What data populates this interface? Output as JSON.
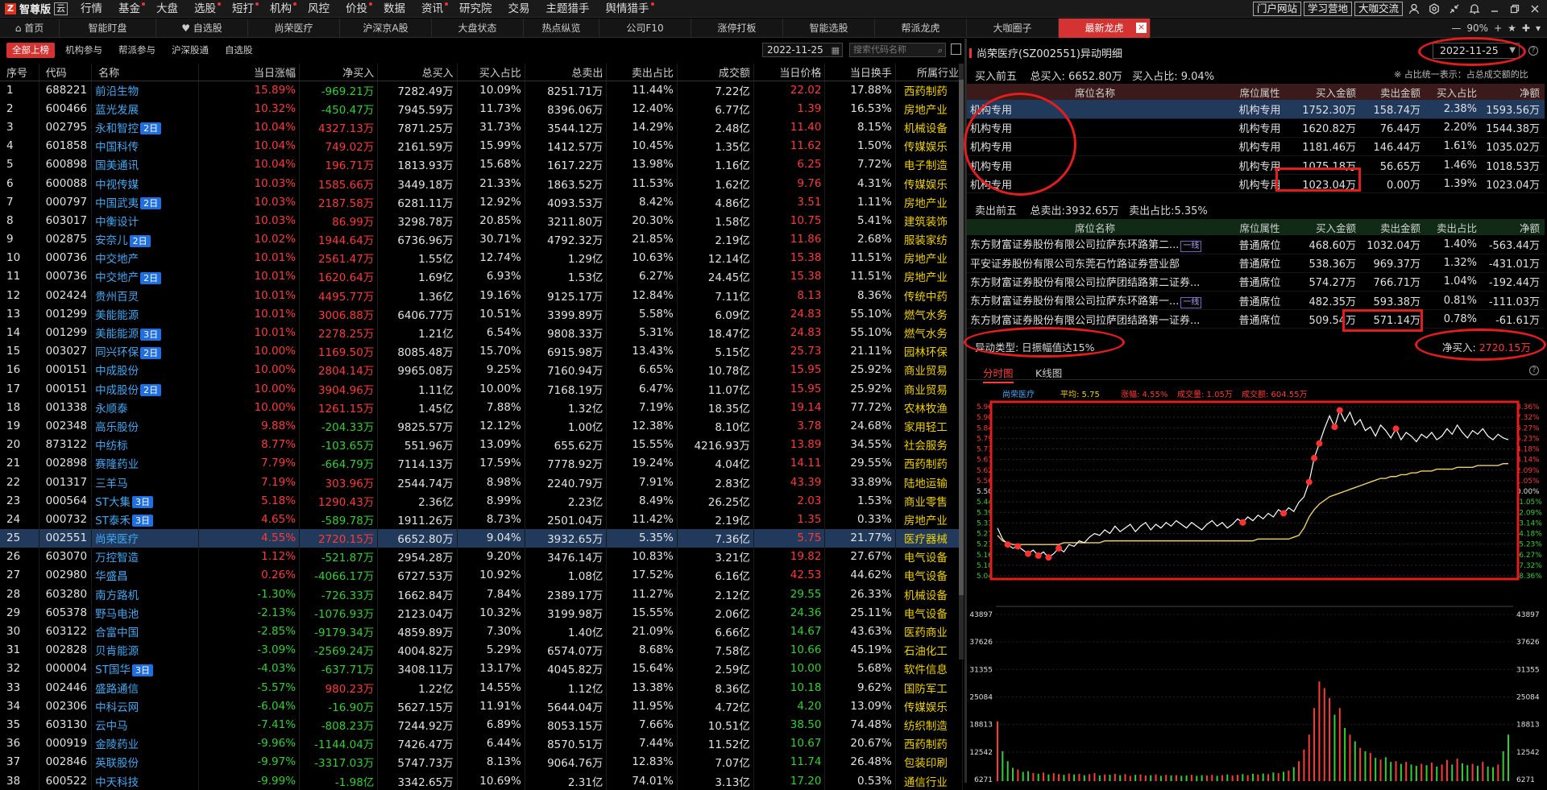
{
  "app": {
    "logo_glyph": "Z",
    "name": "智尊版",
    "edition": "云"
  },
  "menu": [
    {
      "label": "行情",
      "dot": false
    },
    {
      "label": "基金",
      "dot": true
    },
    {
      "label": "大盘",
      "dot": false
    },
    {
      "label": "选股",
      "dot": true
    },
    {
      "label": "短打",
      "dot": true
    },
    {
      "label": "机构",
      "dot": true
    },
    {
      "label": "风控",
      "dot": false
    },
    {
      "label": "价投",
      "dot": true
    },
    {
      "label": "数据",
      "dot": false
    },
    {
      "label": "资讯",
      "dot": true
    },
    {
      "label": "研究院",
      "dot": false
    },
    {
      "label": "交易",
      "dot": false
    },
    {
      "label": "主题猎手",
      "dot": false
    },
    {
      "label": "舆情猎手",
      "dot": true
    }
  ],
  "top_buttons": [
    "门户网站",
    "学习营地",
    "大咖交流"
  ],
  "tabs": [
    "首页",
    "智能盯盘",
    "自选股",
    "尚荣医疗",
    "沪深京A股",
    "大盘状态",
    "热点纵览",
    "公司F10",
    "涨停打板",
    "智能选股",
    "帮派龙虎",
    "大咖圈子",
    "最新龙虎"
  ],
  "tab_right": {
    "zoom": "90%"
  },
  "subtabs": [
    "全部上榜",
    "机构参与",
    "帮派参与",
    "沪深股通",
    "自选股"
  ],
  "date": "2022-11-25",
  "search_placeholder": "搜索代码名称",
  "table": {
    "headers": [
      "序号",
      "代码",
      "名称",
      "当日涨幅",
      "净买入",
      "总买入",
      "买入占比",
      "总卖出",
      "卖出占比",
      "成交额",
      "当日价格",
      "当日换手",
      "所属行业"
    ],
    "selected_row": 24,
    "rows": [
      [
        "1",
        "688221",
        "前沿生物",
        "",
        "15.89%",
        "-969.21万",
        "7282.49万",
        "10.09%",
        "8251.71万",
        "11.44%",
        "7.22亿",
        "22.02",
        "17.88%",
        "西药制药"
      ],
      [
        "2",
        "600466",
        "蓝光发展",
        "",
        "10.32%",
        "-450.47万",
        "7945.59万",
        "11.73%",
        "8396.06万",
        "12.40%",
        "6.77亿",
        "1.39",
        "16.53%",
        "房地产业"
      ],
      [
        "3",
        "002795",
        "永和智控",
        "2日",
        "10.04%",
        "4327.13万",
        "7871.25万",
        "31.73%",
        "3544.12万",
        "14.29%",
        "2.48亿",
        "11.40",
        "8.15%",
        "机械设备"
      ],
      [
        "4",
        "601858",
        "中国科传",
        "",
        "10.04%",
        "749.02万",
        "2161.59万",
        "15.99%",
        "1412.57万",
        "10.45%",
        "1.35亿",
        "11.62",
        "1.50%",
        "传媒娱乐"
      ],
      [
        "5",
        "600898",
        "国美通讯",
        "",
        "10.04%",
        "196.71万",
        "1813.93万",
        "15.68%",
        "1617.22万",
        "13.98%",
        "1.16亿",
        "6.25",
        "7.72%",
        "电子制造"
      ],
      [
        "6",
        "600088",
        "中视传媒",
        "",
        "10.03%",
        "1585.66万",
        "3449.18万",
        "21.33%",
        "1863.52万",
        "11.53%",
        "1.62亿",
        "9.76",
        "4.31%",
        "传媒娱乐"
      ],
      [
        "7",
        "000797",
        "中国武夷",
        "2日",
        "10.03%",
        "2187.58万",
        "6281.11万",
        "12.92%",
        "4093.53万",
        "8.42%",
        "4.86亿",
        "3.51",
        "1.11%",
        "房地产业"
      ],
      [
        "8",
        "603017",
        "中衡设计",
        "",
        "10.03%",
        "86.99万",
        "3298.78万",
        "20.85%",
        "3211.80万",
        "20.30%",
        "1.58亿",
        "10.75",
        "5.41%",
        "建筑装饰"
      ],
      [
        "9",
        "002875",
        "安奈儿",
        "2日",
        "10.02%",
        "1944.64万",
        "6736.96万",
        "30.71%",
        "4792.32万",
        "21.85%",
        "2.19亿",
        "11.86",
        "2.68%",
        "服装家纺"
      ],
      [
        "10",
        "000736",
        "中交地产",
        "",
        "10.01%",
        "2561.47万",
        "1.55亿",
        "12.74%",
        "1.29亿",
        "10.63%",
        "12.14亿",
        "15.38",
        "11.51%",
        "房地产业"
      ],
      [
        "11",
        "000736",
        "中交地产",
        "2日",
        "10.01%",
        "1620.64万",
        "1.69亿",
        "6.93%",
        "1.53亿",
        "6.27%",
        "24.45亿",
        "15.38",
        "11.51%",
        "房地产业"
      ],
      [
        "12",
        "002424",
        "贵州百灵",
        "",
        "10.01%",
        "4495.77万",
        "1.36亿",
        "19.16%",
        "9125.17万",
        "12.84%",
        "7.11亿",
        "8.13",
        "8.36%",
        "传统中药"
      ],
      [
        "13",
        "001299",
        "美能能源",
        "",
        "10.01%",
        "3006.88万",
        "6406.77万",
        "10.51%",
        "3399.89万",
        "5.58%",
        "6.09亿",
        "24.83",
        "55.10%",
        "燃气水务"
      ],
      [
        "14",
        "001299",
        "美能能源",
        "3日",
        "10.01%",
        "2278.25万",
        "1.21亿",
        "6.54%",
        "9808.33万",
        "5.31%",
        "18.47亿",
        "24.83",
        "55.10%",
        "燃气水务"
      ],
      [
        "15",
        "003027",
        "同兴环保",
        "2日",
        "10.00%",
        "1169.50万",
        "8085.48万",
        "15.70%",
        "6915.98万",
        "13.43%",
        "5.15亿",
        "25.73",
        "21.11%",
        "园林环保"
      ],
      [
        "16",
        "000151",
        "中成股份",
        "",
        "10.00%",
        "2804.14万",
        "9965.08万",
        "9.25%",
        "7160.94万",
        "6.65%",
        "10.78亿",
        "15.95",
        "25.92%",
        "商业贸易"
      ],
      [
        "17",
        "000151",
        "中成股份",
        "2日",
        "10.00%",
        "3904.96万",
        "1.11亿",
        "10.00%",
        "7168.19万",
        "6.47%",
        "11.07亿",
        "15.95",
        "25.92%",
        "商业贸易"
      ],
      [
        "18",
        "001338",
        "永顺泰",
        "",
        "10.00%",
        "1261.15万",
        "1.45亿",
        "7.88%",
        "1.32亿",
        "7.19%",
        "18.35亿",
        "19.14",
        "77.72%",
        "农林牧渔"
      ],
      [
        "19",
        "002348",
        "高乐股份",
        "",
        "9.88%",
        "-204.33万",
        "9825.57万",
        "12.12%",
        "1.00亿",
        "12.38%",
        "8.10亿",
        "3.78",
        "24.68%",
        "家用轻工"
      ],
      [
        "20",
        "873122",
        "中纺标",
        "",
        "8.77%",
        "-103.65万",
        "551.96万",
        "13.09%",
        "655.62万",
        "15.55%",
        "4216.93万",
        "13.89",
        "34.55%",
        "社会服务"
      ],
      [
        "21",
        "002898",
        "赛隆药业",
        "",
        "7.79%",
        "-664.79万",
        "7114.13万",
        "17.59%",
        "7778.92万",
        "19.24%",
        "4.04亿",
        "14.11",
        "29.55%",
        "西药制药"
      ],
      [
        "22",
        "001317",
        "三羊马",
        "",
        "7.19%",
        "303.96万",
        "2544.74万",
        "8.98%",
        "2240.79万",
        "7.91%",
        "2.83亿",
        "43.39",
        "33.89%",
        "陆地运输"
      ],
      [
        "23",
        "000564",
        "ST大集",
        "3日",
        "5.18%",
        "1290.43万",
        "2.36亿",
        "8.99%",
        "2.23亿",
        "8.49%",
        "26.25亿",
        "2.03",
        "1.53%",
        "商业零售"
      ],
      [
        "24",
        "000732",
        "ST泰禾",
        "3日",
        "4.65%",
        "-589.78万",
        "1911.26万",
        "8.73%",
        "2501.04万",
        "11.42%",
        "2.19亿",
        "1.35",
        "0.33%",
        "房地产业"
      ],
      [
        "25",
        "002551",
        "尚荣医疗",
        "",
        "4.55%",
        "2720.15万",
        "6652.80万",
        "9.04%",
        "3932.65万",
        "5.35%",
        "7.36亿",
        "5.75",
        "21.77%",
        "医疗器械"
      ],
      [
        "26",
        "603070",
        "万控智造",
        "",
        "1.12%",
        "-521.87万",
        "2954.28万",
        "9.20%",
        "3476.14万",
        "10.83%",
        "3.21亿",
        "19.82",
        "27.67%",
        "电气设备"
      ],
      [
        "27",
        "002980",
        "华盛昌",
        "",
        "0.26%",
        "-4066.17万",
        "6727.53万",
        "10.92%",
        "1.08亿",
        "17.52%",
        "6.16亿",
        "42.53",
        "44.62%",
        "电气设备"
      ],
      [
        "28",
        "603280",
        "南方路机",
        "",
        "-1.30%",
        "-726.33万",
        "1662.84万",
        "7.84%",
        "2389.17万",
        "11.27%",
        "2.12亿",
        "29.55",
        "26.33%",
        "机械设备"
      ],
      [
        "29",
        "605378",
        "野马电池",
        "",
        "-2.13%",
        "-1076.93万",
        "2123.04万",
        "10.32%",
        "3199.98万",
        "15.55%",
        "2.06亿",
        "24.36",
        "25.11%",
        "电气设备"
      ],
      [
        "30",
        "603122",
        "合富中国",
        "",
        "-2.85%",
        "-9179.34万",
        "4859.89万",
        "7.30%",
        "1.40亿",
        "21.09%",
        "6.66亿",
        "14.67",
        "43.63%",
        "医药商业"
      ],
      [
        "31",
        "002828",
        "贝肯能源",
        "",
        "-3.09%",
        "-2569.24万",
        "4004.82万",
        "5.29%",
        "6574.07万",
        "8.68%",
        "7.58亿",
        "10.66",
        "45.19%",
        "石油化工"
      ],
      [
        "32",
        "000004",
        "ST国华",
        "3日",
        "-4.03%",
        "-637.71万",
        "3408.11万",
        "13.17%",
        "4045.82万",
        "15.64%",
        "2.59亿",
        "10.00",
        "5.68%",
        "软件信息"
      ],
      [
        "33",
        "002446",
        "盛路通信",
        "",
        "-5.57%",
        "980.23万",
        "1.22亿",
        "14.55%",
        "1.12亿",
        "13.38%",
        "8.36亿",
        "10.18",
        "9.62%",
        "国防军工"
      ],
      [
        "34",
        "002306",
        "中科云网",
        "",
        "-6.04%",
        "-16.90万",
        "5627.15万",
        "11.91%",
        "5644.04万",
        "11.95%",
        "4.72亿",
        "4.20",
        "13.09%",
        "传媒娱乐"
      ],
      [
        "35",
        "603130",
        "云中马",
        "",
        "-7.41%",
        "-808.23万",
        "7244.92万",
        "6.89%",
        "8053.15万",
        "7.66%",
        "10.51亿",
        "38.50",
        "74.48%",
        "纺织制造"
      ],
      [
        "36",
        "000919",
        "金陵药业",
        "",
        "-9.96%",
        "-1144.04万",
        "7426.47万",
        "6.44%",
        "8570.51万",
        "7.44%",
        "11.52亿",
        "10.67",
        "20.67%",
        "西药制药"
      ],
      [
        "37",
        "002846",
        "英联股份",
        "",
        "-9.97%",
        "-3317.03万",
        "5747.73万",
        "8.13%",
        "9064.76万",
        "12.83%",
        "7.07亿",
        "11.74",
        "26.48%",
        "包装印刷"
      ],
      [
        "38",
        "600522",
        "中天科技",
        "",
        "-9.99%",
        "-1.98亿",
        "3342.65万",
        "10.69%",
        "2.31亿",
        "74.01%",
        "3.13亿",
        "17.20",
        "0.53%",
        "通信行业"
      ]
    ]
  },
  "detail": {
    "title": "尚荣医疗(SZ002551)异动明细",
    "date": "2022-11-25",
    "help": "?",
    "buy_summary": {
      "label": "买入前五",
      "total": "总买入: 6652.80万",
      "ratio": "买入占比: 9.04%"
    },
    "buy_note": "※ 占比统一表示：占总成交额的比",
    "seat_headers": [
      "席位名称",
      "席位属性",
      "买入金额",
      "卖出金额",
      "买入占比",
      "净额"
    ],
    "buy_rows": [
      [
        "机构专用",
        "机构专用",
        "1752.30万",
        "158.74万",
        "2.38%",
        "1593.56万"
      ],
      [
        "机构专用",
        "机构专用",
        "1620.82万",
        "76.44万",
        "2.20%",
        "1544.38万"
      ],
      [
        "机构专用",
        "机构专用",
        "1181.46万",
        "146.44万",
        "1.61%",
        "1035.02万"
      ],
      [
        "机构专用",
        "机构专用",
        "1075.18万",
        "56.65万",
        "1.46%",
        "1018.53万"
      ],
      [
        "机构专用",
        "机构专用",
        "1023.04万",
        "0.00万",
        "1.39%",
        "1023.04万"
      ]
    ],
    "sell_summary": {
      "label": "卖出前五",
      "total": "总卖出:3932.65万",
      "ratio": "卖出占比:5.35%"
    },
    "sell_headers": [
      "席位名称",
      "席位属性",
      "买入金额",
      "卖出金额",
      "卖出占比",
      "净额"
    ],
    "sell_rows": [
      [
        "东方财富证券股份有限公司拉萨东环路第二...",
        "一线",
        "普通席位",
        "468.60万",
        "1032.04万",
        "1.40%",
        "-563.44万"
      ],
      [
        "平安证券股份有限公司东莞石竹路证券营业部",
        "",
        "普通席位",
        "538.36万",
        "969.37万",
        "1.32%",
        "-431.01万"
      ],
      [
        "东方财富证券股份有限公司拉萨团结路第二证券...",
        "",
        "普通席位",
        "574.27万",
        "766.71万",
        "1.04%",
        "-192.44万"
      ],
      [
        "东方财富证券股份有限公司拉萨东环路第一...",
        "一线",
        "普通席位",
        "482.35万",
        "593.38万",
        "0.81%",
        "-111.03万"
      ],
      [
        "东方财富证券股份有限公司拉萨团结路第一证券...",
        "",
        "普通席位",
        "509.54万",
        "571.14万",
        "0.78%",
        "-61.61万"
      ]
    ],
    "abnormal_type": "异动类型: 日振幅值达15%",
    "net_buy_label": "净买入: ",
    "net_buy_value": "2720.15万"
  },
  "chart_tabs": [
    "分时图",
    "K线图"
  ],
  "chart_data": {
    "type": "line",
    "header": {
      "name": "尚荣医疗",
      "avg": "平均: 5.75",
      "change": "涨幅: 4.55%",
      "vol": "成交量: 1.05万",
      "amount": "成交额: 604.55万"
    },
    "price_ticks": [
      "5.96",
      "5.90",
      "5.84",
      "5.79",
      "5.73",
      "5.67",
      "5.62",
      "5.56",
      "5.50",
      "5.44",
      "5.39",
      "5.33",
      "5.27",
      "5.21",
      "5.16",
      "5.10",
      "5.04"
    ],
    "pct_ticks": [
      "8.36%",
      "7.32%",
      "6.27%",
      "5.23%",
      "4.18%",
      "3.14%",
      "2.09%",
      "1.05%",
      "0.00%",
      "-1.05%",
      "-2.09%",
      "-3.14%",
      "-4.18%",
      "-5.23%",
      "-6.27%",
      "-7.32%",
      "-8.36%"
    ],
    "volume_ticks": [
      "43897",
      "37626",
      "31355",
      "25084",
      "18813",
      "12542",
      "6271"
    ],
    "ylim": [
      5.04,
      5.96
    ],
    "prev_close": 5.5,
    "price_series": [
      5.3,
      5.24,
      5.21,
      5.19,
      5.2,
      5.18,
      5.16,
      5.18,
      5.15,
      5.17,
      5.14,
      5.16,
      5.19,
      5.17,
      5.21,
      5.2,
      5.23,
      5.22,
      5.25,
      5.27,
      5.26,
      5.29,
      5.27,
      5.31,
      5.28,
      5.3,
      5.32,
      5.28,
      5.31,
      5.33,
      5.29,
      5.32,
      5.3,
      5.33,
      5.31,
      5.34,
      5.32,
      5.3,
      5.33,
      5.31,
      5.29,
      5.32,
      5.34,
      5.31,
      5.33,
      5.3,
      5.32,
      5.35,
      5.33,
      5.36,
      5.34,
      5.37,
      5.35,
      5.38,
      5.36,
      5.4,
      5.38,
      5.41,
      5.39,
      5.44,
      5.47,
      5.55,
      5.68,
      5.76,
      5.84,
      5.91,
      5.85,
      5.94,
      5.88,
      5.93,
      5.86,
      5.89,
      5.83,
      5.85,
      5.8,
      5.86,
      5.83,
      5.79,
      5.84,
      5.78,
      5.82,
      5.8,
      5.77,
      5.81,
      5.79,
      5.82,
      5.78,
      5.8,
      5.84,
      5.81,
      5.86,
      5.82,
      5.79,
      5.83,
      5.81,
      5.84,
      5.8,
      5.78,
      5.81,
      5.79,
      5.78
    ],
    "avg_series": [
      5.26,
      5.23,
      5.22,
      5.21,
      5.21,
      5.21,
      5.21,
      5.21,
      5.21,
      5.21,
      5.21,
      5.21,
      5.21,
      5.22,
      5.22,
      5.22,
      5.22,
      5.22,
      5.22,
      5.22,
      5.22,
      5.23,
      5.23,
      5.23,
      5.23,
      5.23,
      5.23,
      5.23,
      5.23,
      5.23,
      5.23,
      5.23,
      5.23,
      5.23,
      5.23,
      5.23,
      5.23,
      5.23,
      5.23,
      5.23,
      5.23,
      5.23,
      5.23,
      5.23,
      5.23,
      5.23,
      5.23,
      5.23,
      5.23,
      5.23,
      5.23,
      5.24,
      5.24,
      5.24,
      5.24,
      5.24,
      5.24,
      5.24,
      5.25,
      5.26,
      5.3,
      5.36,
      5.4,
      5.43,
      5.45,
      5.47,
      5.48,
      5.49,
      5.5,
      5.51,
      5.52,
      5.53,
      5.54,
      5.55,
      5.56,
      5.57,
      5.57,
      5.58,
      5.58,
      5.59,
      5.59,
      5.6,
      5.6,
      5.61,
      5.61,
      5.61,
      5.62,
      5.62,
      5.62,
      5.62,
      5.63,
      5.63,
      5.63,
      5.63,
      5.64,
      5.64,
      5.64,
      5.64,
      5.64,
      5.65,
      5.65
    ],
    "markers": [
      2,
      4,
      6,
      8,
      10,
      12,
      48,
      56,
      61,
      62,
      63,
      66,
      67,
      78
    ],
    "volume_series": [
      18000,
      9000,
      6000,
      4000,
      3500,
      2800,
      3000,
      2500,
      2200,
      2600,
      2000,
      2400,
      2100,
      1900,
      2300,
      2000,
      2200,
      1800,
      2100,
      2400,
      1700,
      2000,
      1900,
      2200,
      1800,
      2100,
      1600,
      1900,
      2000,
      1700,
      1800,
      2000,
      1600,
      1900,
      1700,
      1800,
      1600,
      1700,
      1900,
      1600,
      1800,
      1700,
      1900,
      1600,
      1800,
      2000,
      1700,
      1900,
      2100,
      1800,
      2200,
      2000,
      2300,
      2100,
      2600,
      2400,
      2800,
      3200,
      4200,
      6000,
      9500,
      14000,
      22000,
      30000,
      28000,
      25000,
      20000,
      22000,
      16000,
      14000,
      12000,
      10000,
      9000,
      8500,
      7000,
      6500,
      7200,
      5800,
      6000,
      5200,
      5800,
      5000,
      4600,
      5200,
      4800,
      5600,
      4400,
      5000,
      6400,
      5000,
      6800,
      5400,
      4800,
      5200,
      4600,
      5800,
      4400,
      4200,
      5000,
      9000,
      14000
    ]
  },
  "colors": {
    "up": "#ff3838",
    "down": "#30d030",
    "accent": "#d53232",
    "link": "#3fa9f5",
    "industry": "#f0d000",
    "highlight": "#e41c1c"
  }
}
